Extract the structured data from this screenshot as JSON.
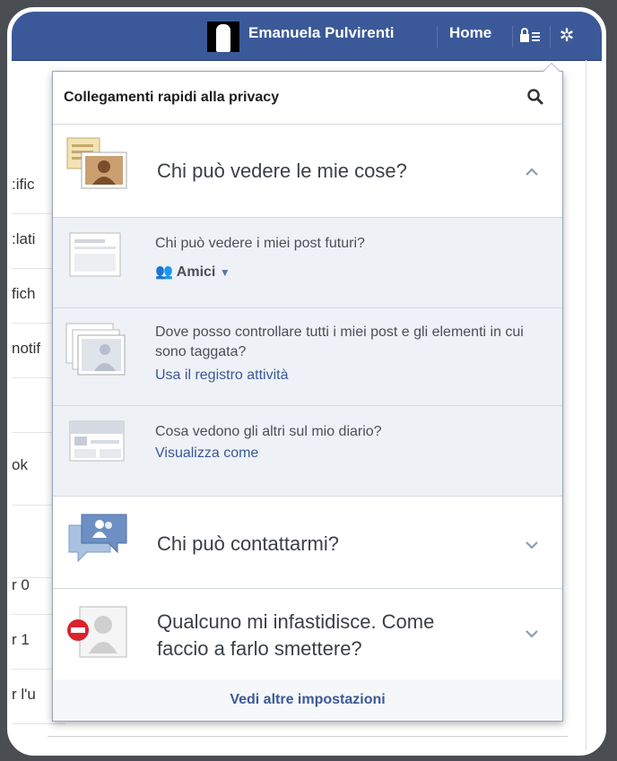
{
  "topbar": {
    "user_name": "Emanuela Pulvirenti",
    "home_label": "Home"
  },
  "background_rows": [
    {
      "text": ":ific"
    },
    {
      "text": ":lati"
    },
    {
      "text": "fich"
    },
    {
      "text": "notif"
    },
    {
      "text": ""
    },
    {
      "text": "ok"
    },
    {
      "text": ""
    },
    {
      "text": "r 0"
    },
    {
      "text": "r 1"
    },
    {
      "text": "r l'u"
    }
  ],
  "popup": {
    "title": "Collegamenti rapidi alla privacy",
    "sections": {
      "see_things": {
        "title": "Chi può vedere le mie cose?",
        "items": {
          "future_posts": {
            "question": "Chi può vedere i miei post futuri?",
            "audience": "Amici"
          },
          "review_posts": {
            "text": "Dove posso controllare tutti i miei post e gli elementi in cui sono taggata?",
            "link": "Usa il registro attività"
          },
          "view_as": {
            "text": "Cosa vedono gli altri sul mio diario?",
            "link": "Visualizza come"
          }
        }
      },
      "contact": {
        "title": "Chi può contattarmi?"
      },
      "annoying": {
        "title_line1": "Qualcuno mi infastidisce. Come",
        "title_line2": "faccio a farlo smettere?"
      }
    },
    "footer_link": "Vedi altre impostazioni"
  }
}
